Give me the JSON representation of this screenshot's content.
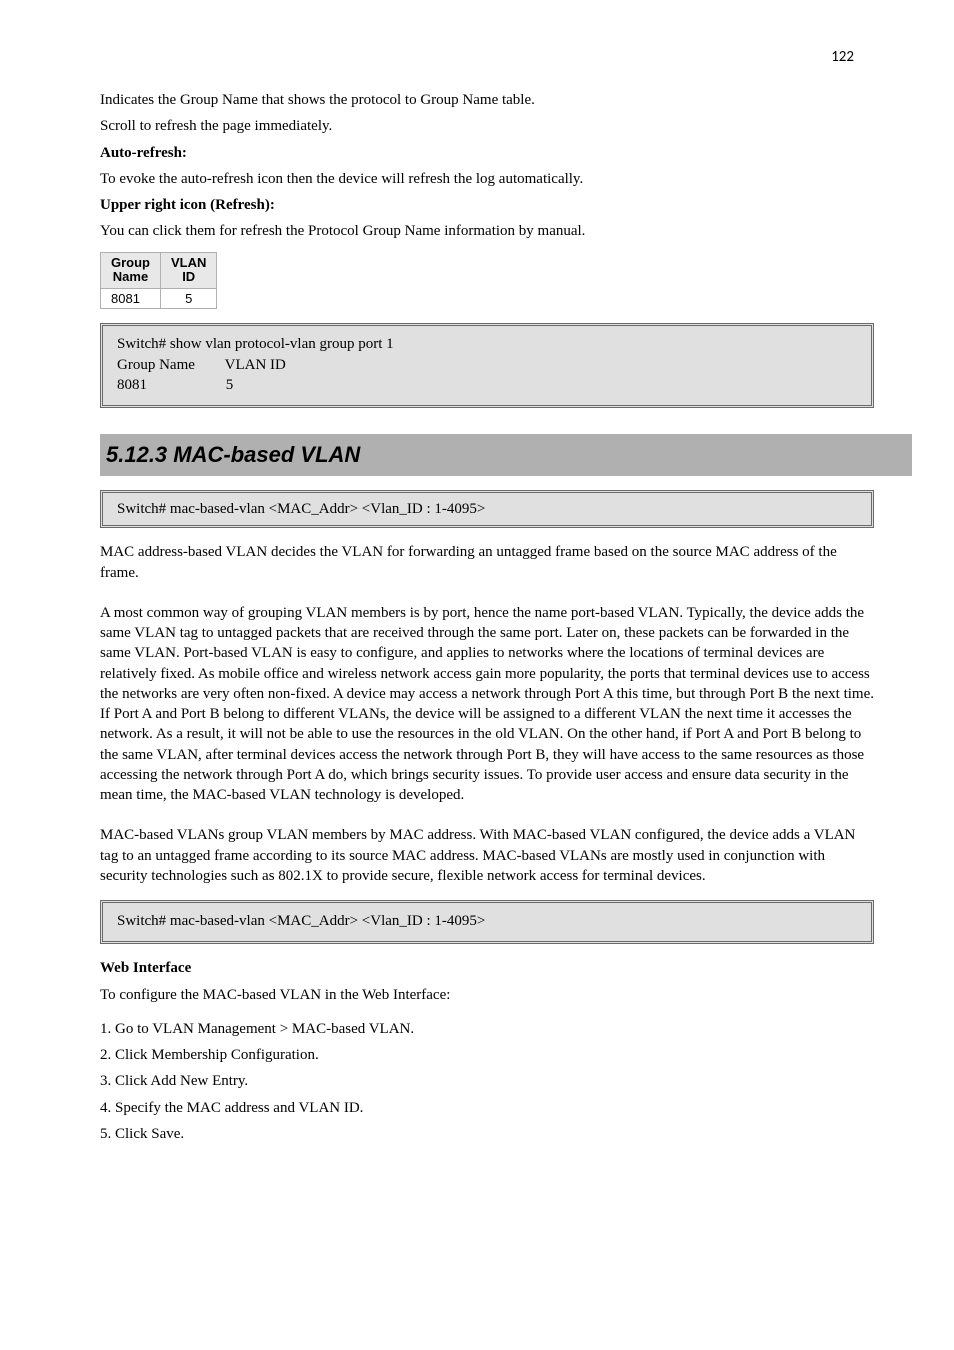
{
  "pageNumber": "122",
  "intro1": "Indicates the Group Name that shows the protocol to Group Name table.",
  "intro2": "Scroll to refresh the page immediately.",
  "intro3": "Auto-refresh:",
  "intro4": "To evoke the auto-refresh icon then the device will refresh the log automatically.",
  "intro5": "Upper right icon (Refresh):",
  "intro6": "You can click them for refresh the Protocol Group Name information by manual.",
  "table": {
    "h1a": "Group",
    "h1b": "Name",
    "h2a": "VLAN",
    "h2b": "ID",
    "r1c1": "8081",
    "r1c2": "5"
  },
  "cli1_l1": "Switch# show vlan protocol-vlan group port 1",
  "cli1_l2": "Group Name        VLAN ID",
  "cli1_l3": "8081                     5",
  "sectionHeading": "5.12.3 MAC-based VLAN",
  "mac_p1": "MAC address-based VLAN decides the VLAN for forwarding an untagged frame based on the source MAC address of the frame.",
  "mac_p2": "A most common way of grouping VLAN members is by port, hence the name port-based VLAN. Typically, the device adds the same VLAN tag to untagged packets that are received through the same port. Later on, these packets can be forwarded in the same VLAN. Port-based VLAN is easy to configure, and applies to networks where the locations of terminal devices are relatively fixed. As mobile office and wireless network access gain more popularity, the ports that terminal devices use to access the networks are very often non-fixed. A device may access a network through Port A this time, but through Port B the next time. If Port A and Port B belong to different VLANs, the device will be assigned to a different VLAN the next time it accesses the network. As a result, it will not be able to use the resources in the old VLAN. On the other hand, if Port A and Port B belong to the same VLAN, after terminal devices access the network through Port B, they will have access to the same resources as those accessing the network through Port A do, which brings security issues. To provide user access and ensure data security in the mean time, the MAC-based VLAN technology is developed.",
  "mac_p3": "MAC-based VLANs group VLAN members by MAC address. With MAC-based VLAN configured, the device adds a VLAN tag to an untagged frame according to its source MAC address. MAC-based VLANs are mostly used in conjunction with security technologies such as 802.1X to provide secure, flexible network access for terminal devices.",
  "cli2_l1": "Switch# mac-based-vlan <MAC_Addr> <Vlan_ID : 1-4095>",
  "webHeading": "Web Interface",
  "web_intro": "To configure the MAC-based VLAN in the Web Interface:",
  "web_step1": "1. Go to VLAN Management > MAC-based VLAN.",
  "web_step2": "2. Click Membership Configuration.",
  "web_step3": "3. Click Add New Entry.",
  "web_step4": "4. Specify the MAC address and VLAN ID.",
  "web_step5": "5. Click Save."
}
